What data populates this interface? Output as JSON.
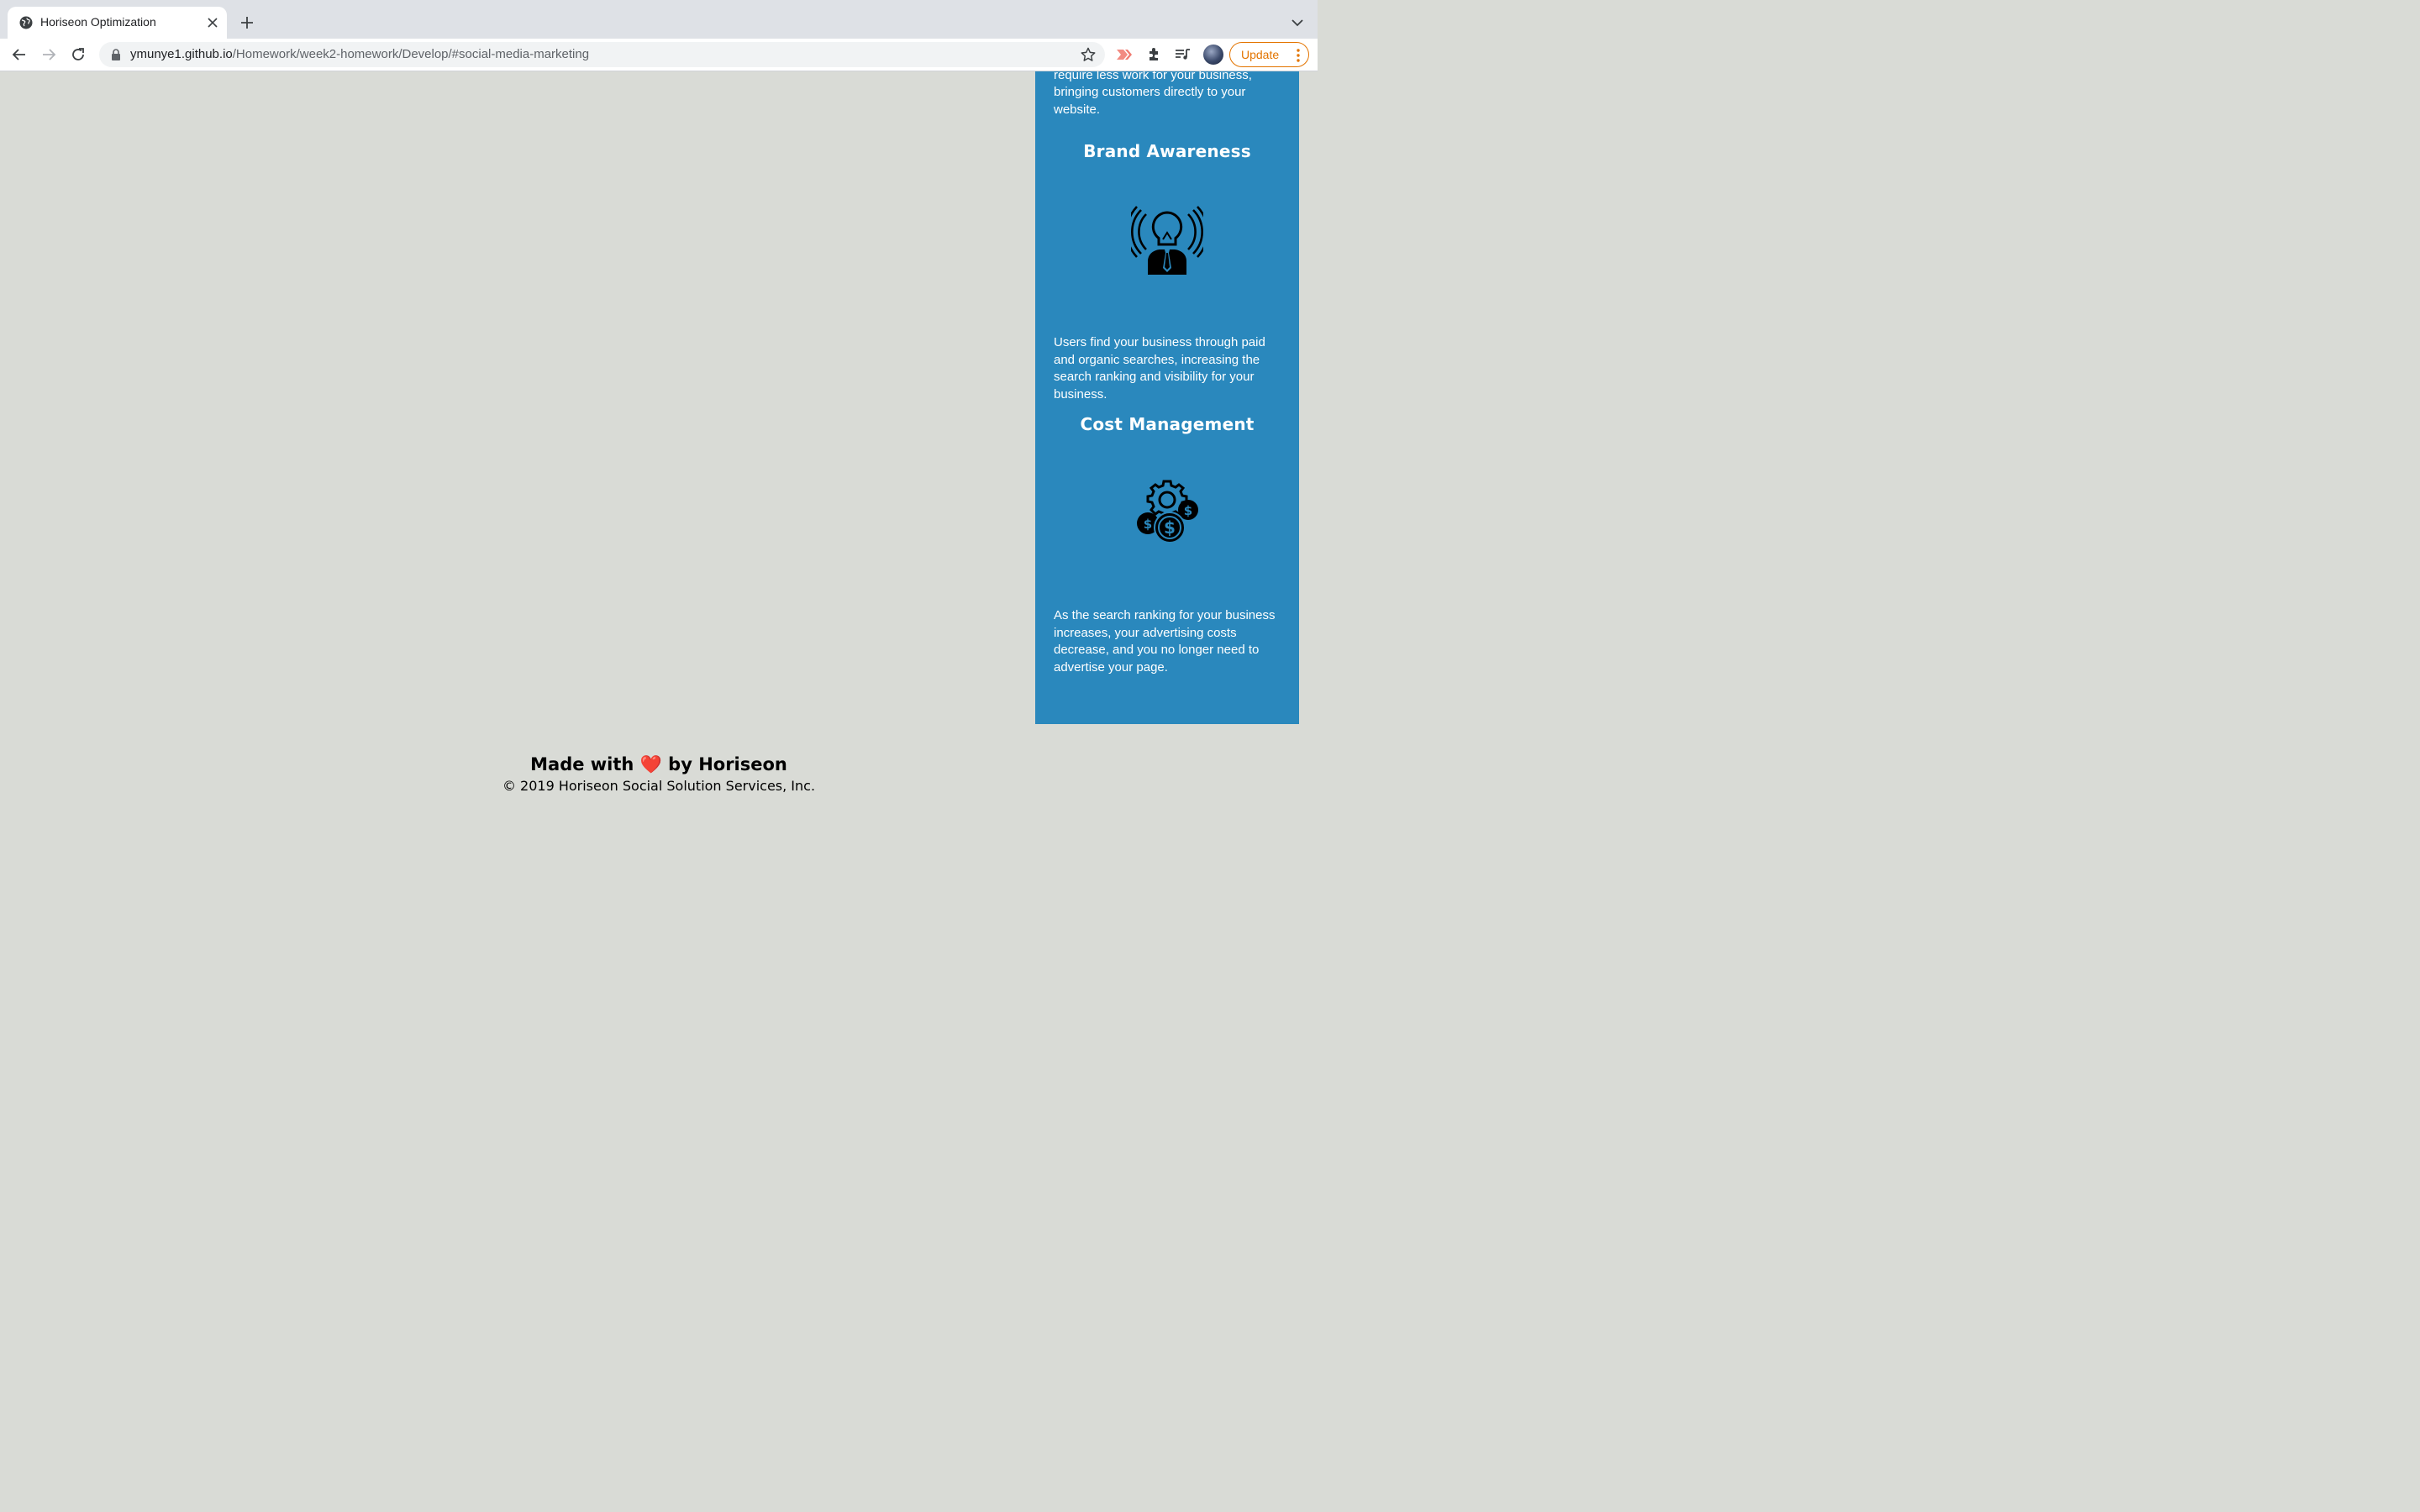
{
  "browser": {
    "tab_title": "Horiseon Optimization",
    "url_host": "ymunye1.github.io",
    "url_path": "/Homework/week2-homework/Develop/#social-media-marketing",
    "update_label": "Update"
  },
  "benefits": {
    "lead_generation_text": "Inbound strategies for lead generation require less work for your business, bringing customers directly to your website.",
    "brand_awareness": {
      "heading": "Brand Awareness",
      "icon": "brand-awareness-lightbulb-icon",
      "text": "Users find your business through paid and organic searches, increasing the search ranking and visibility for your business."
    },
    "cost_management": {
      "heading": "Cost Management",
      "icon": "cost-management-gear-dollar-icon",
      "text": "As the search ranking for your business increases, your advertising costs decrease, and you no longer need to advertise your page."
    }
  },
  "footer": {
    "made_with_prefix": "Made with",
    "heart": "❤️",
    "made_with_suffix": "by Horiseon",
    "copyright": "© 2019 Horiseon Social Solution Services, Inc."
  },
  "colors": {
    "benefits_bg": "#2a88bd",
    "page_bg": "#d9dbd6",
    "update_accent": "#e37400"
  }
}
